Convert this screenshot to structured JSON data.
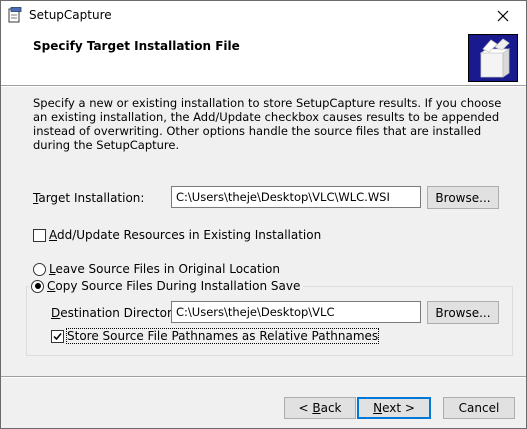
{
  "window": {
    "title": "SetupCapture"
  },
  "header": {
    "title": "Specify Target Installation File"
  },
  "description": "Specify a new or existing installation to store SetupCapture results. If you choose an existing installation, the Add/Update checkbox causes results to be appended instead of overwriting. Other options handle the source files that are installed during the SetupCapture.",
  "target": {
    "label_prefix": "",
    "label_accel": "T",
    "label_rest": "arget Installation:",
    "value": "C:\\Users\\theje\\Desktop\\VLC\\WLC.WSI",
    "browse_accel": "Browse",
    "browse_rest": "..."
  },
  "add_update": {
    "accel": "A",
    "rest": "dd/Update Resources in Existing Installation",
    "checked": false
  },
  "leave_source": {
    "accel": "L",
    "rest": "eave Source Files in Original Location",
    "selected": false
  },
  "copy_source": {
    "accel": "C",
    "rest": "opy Source Files During Installation Save",
    "selected": true
  },
  "destination": {
    "accel": "D",
    "rest": "estination Directory:",
    "value": "C:\\Users\\theje\\Desktop\\VLC",
    "browse_label": "Browse..."
  },
  "relative": {
    "label": "Store Source File Pathnames as Relative Pathnames",
    "checked": true
  },
  "footer": {
    "back_prefix": "< ",
    "back_accel": "B",
    "back_rest": "ack",
    "next_accel": "N",
    "next_rest": "ext >",
    "cancel_label": "Cancel"
  },
  "icons": {
    "app": "setupcapture-app-icon",
    "close": "close-icon",
    "logo": "box-package-icon"
  },
  "colors": {
    "logo_bg": "#1a1a8f",
    "primary_border": "#0078d7"
  }
}
